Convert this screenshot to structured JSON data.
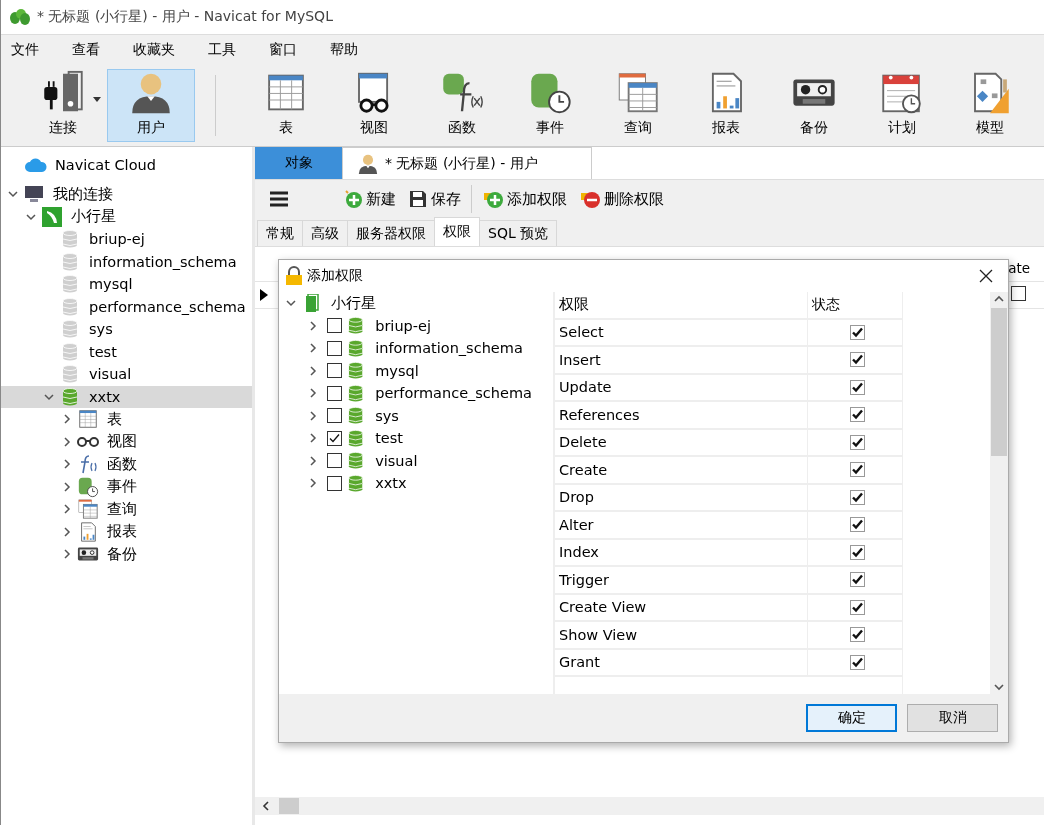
{
  "window": {
    "title": "* 无标题 (小行星) - 用户 - Navicat for MySQL"
  },
  "menu": [
    "文件",
    "查看",
    "收藏夹",
    "工具",
    "窗口",
    "帮助"
  ],
  "toolbar": [
    {
      "label": "连接",
      "kind": "connect",
      "selected": false,
      "dropdown": true
    },
    {
      "label": "用户",
      "kind": "user",
      "selected": true
    },
    {
      "label": "表",
      "kind": "table",
      "selected": false
    },
    {
      "label": "视图",
      "kind": "view",
      "selected": false
    },
    {
      "label": "函数",
      "kind": "function",
      "selected": false
    },
    {
      "label": "事件",
      "kind": "event",
      "selected": false
    },
    {
      "label": "查询",
      "kind": "query",
      "selected": false
    },
    {
      "label": "报表",
      "kind": "report",
      "selected": false
    },
    {
      "label": "备份",
      "kind": "backup",
      "selected": false
    },
    {
      "label": "计划",
      "kind": "schedule",
      "selected": false
    },
    {
      "label": "模型",
      "kind": "model",
      "selected": false
    }
  ],
  "sidebar": {
    "cloud": "Navicat Cloud",
    "tree": [
      {
        "label": "我的连接",
        "kind": "computer",
        "expanded": true,
        "selected": false,
        "children": [
          {
            "label": "小行星",
            "kind": "connection",
            "expanded": true,
            "selected": false,
            "children": [
              {
                "label": "briup-ej",
                "kind": "db-closed",
                "selected": false
              },
              {
                "label": "information_schema",
                "kind": "db-closed",
                "selected": false
              },
              {
                "label": "mysql",
                "kind": "db-closed",
                "selected": false
              },
              {
                "label": "performance_schema",
                "kind": "db-closed",
                "selected": false
              },
              {
                "label": "sys",
                "kind": "db-closed",
                "selected": false
              },
              {
                "label": "test",
                "kind": "db-closed",
                "selected": false
              },
              {
                "label": "visual",
                "kind": "db-closed",
                "selected": false
              },
              {
                "label": "xxtx",
                "kind": "db-open",
                "expanded": true,
                "selected": true,
                "children": [
                  {
                    "label": "表",
                    "kind": "table",
                    "expanded": false,
                    "selected": false
                  },
                  {
                    "label": "视图",
                    "kind": "view",
                    "expanded": false,
                    "selected": false
                  },
                  {
                    "label": "函数",
                    "kind": "function",
                    "expanded": false,
                    "selected": false
                  },
                  {
                    "label": "事件",
                    "kind": "event",
                    "expanded": false,
                    "selected": false
                  },
                  {
                    "label": "查询",
                    "kind": "query",
                    "expanded": false,
                    "selected": false
                  },
                  {
                    "label": "报表",
                    "kind": "report",
                    "expanded": false,
                    "selected": false
                  },
                  {
                    "label": "备份",
                    "kind": "backup",
                    "expanded": false,
                    "selected": false
                  }
                ]
              }
            ]
          }
        ]
      }
    ]
  },
  "editor_tabs": [
    {
      "label": "对象",
      "kind": "objects",
      "selected": true
    },
    {
      "label": "* 无标题 (小行星) - 用户",
      "kind": "user",
      "selected": false
    }
  ],
  "editor_toolbar": [
    {
      "label": "新建",
      "kind": "new"
    },
    {
      "label": "保存",
      "kind": "save"
    },
    {
      "label": "添加权限",
      "kind": "add"
    },
    {
      "label": "删除权限",
      "kind": "remove"
    }
  ],
  "sub_tabs": [
    {
      "label": "常规",
      "selected": false
    },
    {
      "label": "高级",
      "selected": false
    },
    {
      "label": "服务器权限",
      "selected": false
    },
    {
      "label": "权限",
      "selected": true
    },
    {
      "label": "SQL 预览",
      "selected": false
    }
  ],
  "grid": {
    "column_heading": "ate",
    "row_checked": false
  },
  "dialog": {
    "title": "添加权限",
    "tree": {
      "label": "小行星",
      "expanded": true,
      "children": [
        {
          "label": "briup-ej",
          "checked": false,
          "expanded": false
        },
        {
          "label": "information_schema",
          "checked": false,
          "expanded": false
        },
        {
          "label": "mysql",
          "checked": false,
          "expanded": false
        },
        {
          "label": "performance_schema",
          "checked": false,
          "expanded": false
        },
        {
          "label": "sys",
          "checked": false,
          "expanded": false
        },
        {
          "label": "test",
          "checked": true,
          "expanded": false
        },
        {
          "label": "visual",
          "checked": false,
          "expanded": false
        },
        {
          "label": "xxtx",
          "checked": false,
          "expanded": false
        }
      ]
    },
    "columns": [
      "权限",
      "状态"
    ],
    "privileges": [
      {
        "name": "Select",
        "checked": true
      },
      {
        "name": "Insert",
        "checked": true
      },
      {
        "name": "Update",
        "checked": true
      },
      {
        "name": "References",
        "checked": true
      },
      {
        "name": "Delete",
        "checked": true
      },
      {
        "name": "Create",
        "checked": true
      },
      {
        "name": "Drop",
        "checked": true
      },
      {
        "name": "Alter",
        "checked": true
      },
      {
        "name": "Index",
        "checked": true
      },
      {
        "name": "Trigger",
        "checked": true
      },
      {
        "name": "Create View",
        "checked": true
      },
      {
        "name": "Show View",
        "checked": true
      },
      {
        "name": "Grant",
        "checked": true
      }
    ],
    "buttons": [
      {
        "label": "确定",
        "kind": "default"
      },
      {
        "label": "取消",
        "kind": "normal"
      }
    ]
  }
}
